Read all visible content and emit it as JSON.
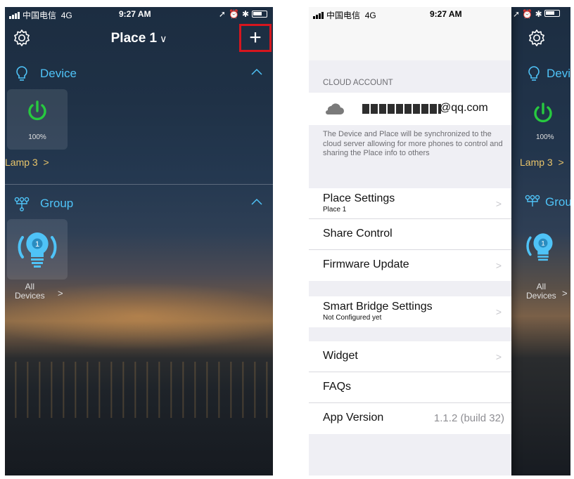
{
  "status": {
    "carrier": "中国电信",
    "network": "4G",
    "time": "9:27 AM"
  },
  "left": {
    "title": "Place 1",
    "title_caret": "∨",
    "add_label": "+",
    "device_section": "Device",
    "device_tile_percent": "100%",
    "device_name": "Lamp 3",
    "device_name_chevron": ">",
    "group_section": "Group",
    "group_badge": "1",
    "group_name_line1": "All",
    "group_name_line2": "Devices",
    "group_name_chevron": ">"
  },
  "right": {
    "cloud_account_label": "CLOUD ACCOUNT",
    "email_visible": "@qq.com",
    "info": "The Device and Place will be synchronized to the cloud server allowing for more phones to control and sharing the Place info to others",
    "place_settings": "Place Settings",
    "place_settings_sub": "Place 1",
    "share_control": "Share Control",
    "firmware_update": "Firmware Update",
    "smart_bridge": "Smart Bridge Settings",
    "smart_bridge_sub": "Not Configured yet",
    "widget": "Widget",
    "faqs": "FAQs",
    "app_version": "App Version",
    "app_version_value": "1.1.2 (build 32)",
    "chevron": ">",
    "peek_device": "Devic",
    "peek_percent": "100%",
    "peek_lamp": "Lamp 3",
    "peek_lamp_chevron": ">",
    "peek_group": "Grou",
    "peek_badge": "1",
    "peek_all": "All",
    "peek_devices": "Devices",
    "peek_devices_chevron": ">"
  },
  "colors": {
    "accent": "#4fc3f7",
    "power_green": "#27c93f",
    "highlight_red": "#d6161e",
    "item_label_gold": "#e8c46a"
  },
  "icons": [
    "gear-icon",
    "plus-icon",
    "bulb-icon",
    "power-icon",
    "group-icon",
    "caret-up-icon",
    "cloud-icon",
    "chevron-right-icon"
  ]
}
